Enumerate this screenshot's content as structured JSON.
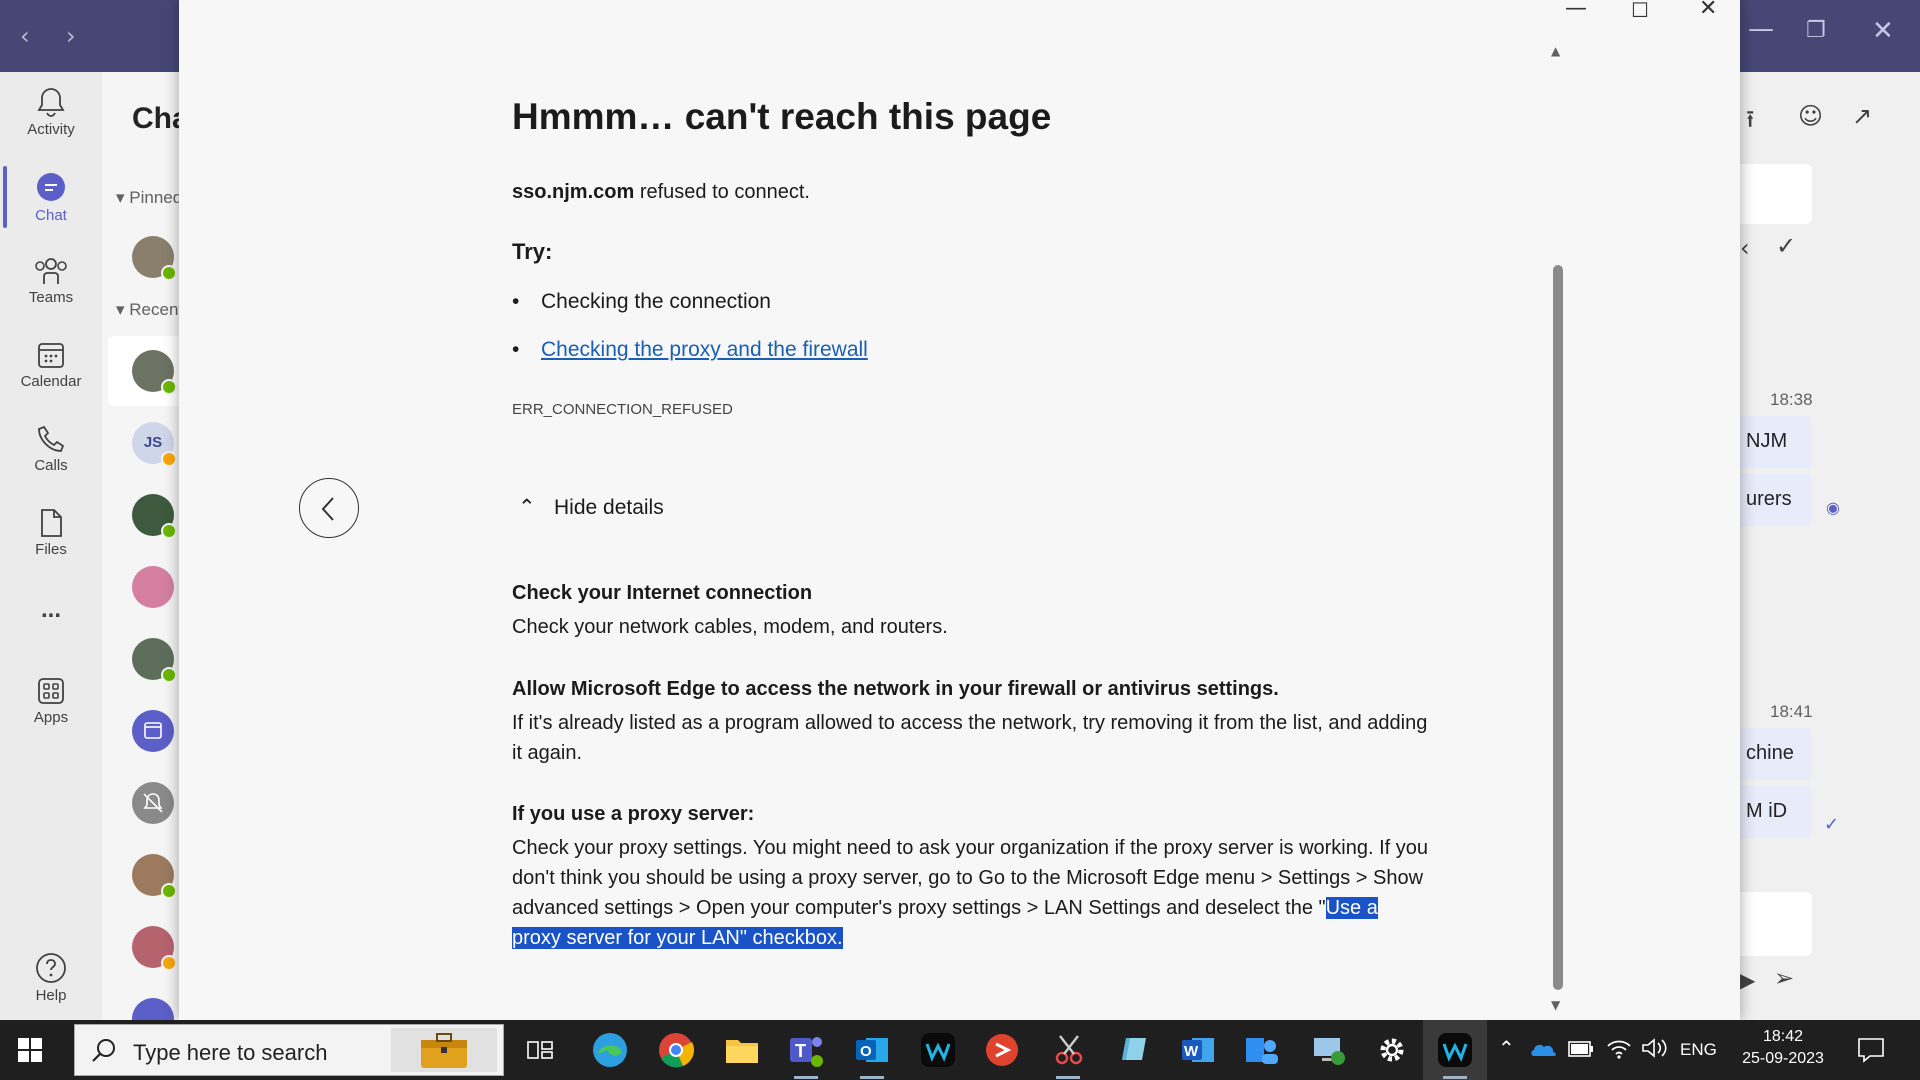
{
  "teams": {
    "rail": [
      {
        "label": "Activity",
        "icon": "bell-icon"
      },
      {
        "label": "Chat",
        "icon": "chat-icon"
      },
      {
        "label": "Teams",
        "icon": "teams-icon"
      },
      {
        "label": "Calendar",
        "icon": "calendar-icon"
      },
      {
        "label": "Calls",
        "icon": "phone-icon"
      },
      {
        "label": "Files",
        "icon": "file-icon"
      },
      {
        "label": "Apps",
        "icon": "apps-icon"
      },
      {
        "label": "Help",
        "icon": "help-icon"
      }
    ],
    "more_label": "...",
    "chat_title": "Chat",
    "pinned_label": "Pinned",
    "recent_label": "Recent",
    "js_initials": "JS",
    "right": {
      "time1": "18:38",
      "msg1": "NJM",
      "msg2": "urers",
      "time2": "18:41",
      "msg3": "chine",
      "msg4": "M iD"
    }
  },
  "edge": {
    "title": "Hmmm… can't reach this page",
    "domain": "sso.njm.com",
    "refused_text": " refused to connect.",
    "try_label": "Try:",
    "bullets": [
      "Checking the connection",
      "Checking the proxy and the firewall"
    ],
    "error_code": "ERR_CONNECTION_REFUSED",
    "hide_details": "Hide details",
    "details": [
      {
        "heading": "Check your Internet connection",
        "body": "Check your network cables, modem, and routers."
      },
      {
        "heading": "Allow Microsoft Edge to access the network in your firewall or antivirus settings.",
        "body": "If it's already listed as a program allowed to access the network, try removing it from the list, and adding it again."
      },
      {
        "heading": "If you use a proxy server:",
        "body": "Check your proxy settings. You might need to ask your organization if the proxy server is working. If you don't think you should be using a proxy server, go to Go to the Microsoft Edge menu > Settings > Show advanced settings > Open your computer's proxy settings > LAN Settings and deselect the \"",
        "highlight": "Use a proxy server for your LAN\" checkbox."
      }
    ]
  },
  "taskbar": {
    "search_placeholder": "Type here to search",
    "language": "ENG",
    "time": "18:42",
    "date": "25-09-2023"
  },
  "colors": {
    "teams_purple": "#464775",
    "teams_accent": "#5b5fc7",
    "link": "#1a5fb4",
    "highlight": "#1a53c7"
  }
}
